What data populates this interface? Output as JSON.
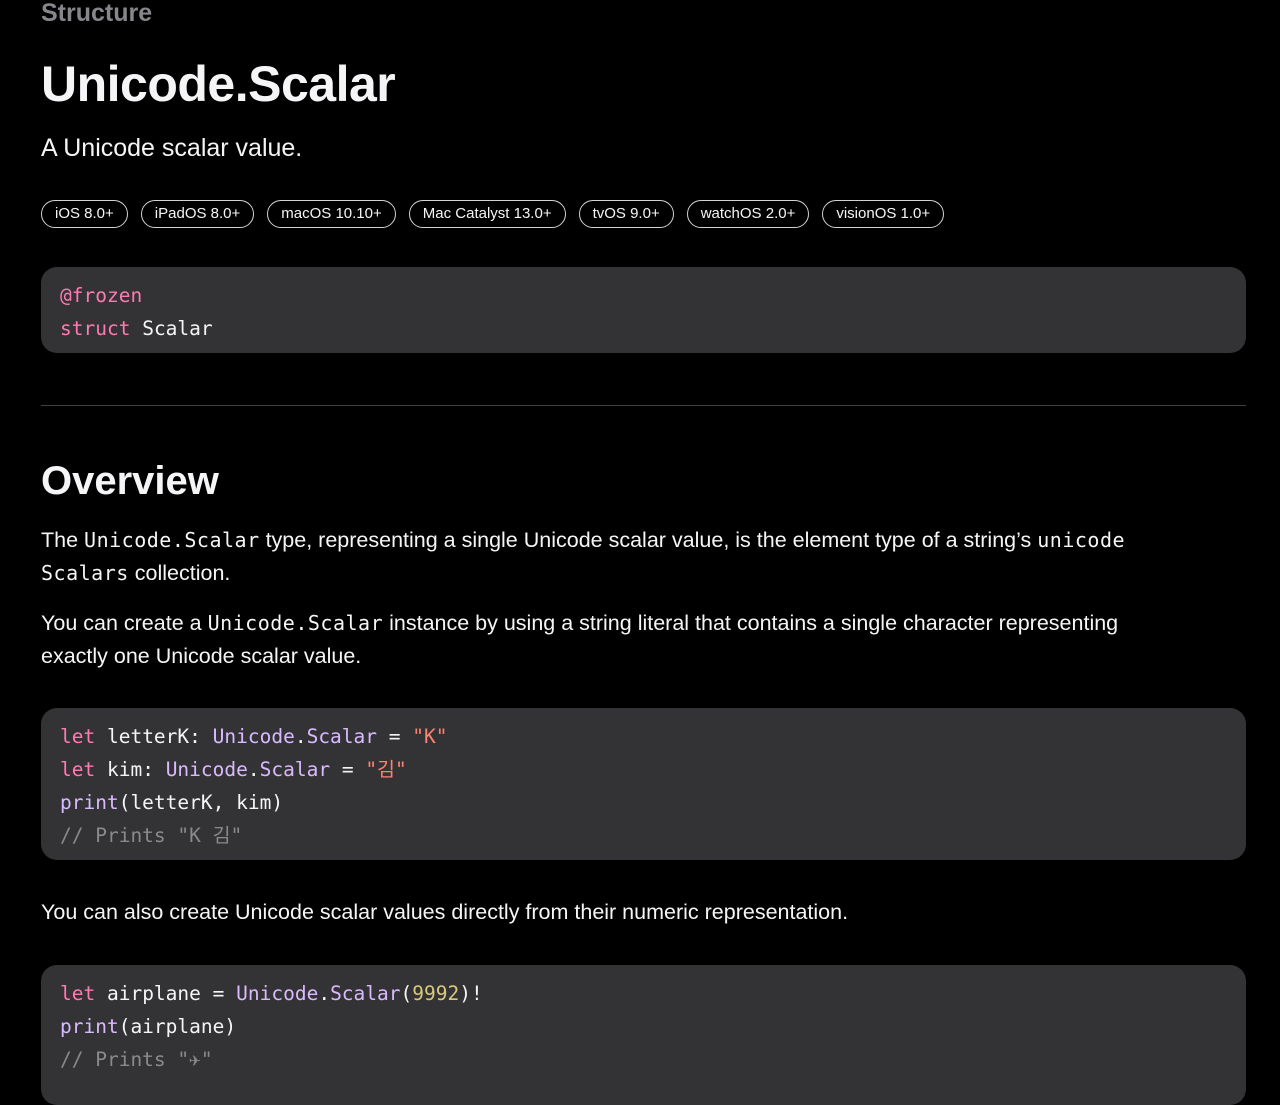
{
  "header": {
    "eyebrow": "Structure",
    "title": "Unicode.Scalar",
    "abstract": "A Unicode scalar value."
  },
  "availability": [
    "iOS 8.0+",
    "iPadOS 8.0+",
    "macOS 10.10+",
    "Mac Catalyst 13.0+",
    "tvOS 9.0+",
    "watchOS 2.0+",
    "visionOS 1.0+"
  ],
  "declaration": {
    "attribute": "@frozen",
    "keyword": "struct",
    "name": "Scalar"
  },
  "overview": {
    "heading": "Overview",
    "p1": {
      "t1": "The ",
      "c1": "Unicode.Scalar",
      "t2": " type, representing a single Unicode scalar value, is the element type of a string’s ",
      "c2a": "unicode",
      "c2b": "Scalars",
      "t3": " collection."
    },
    "p2": {
      "t1": "You can create a ",
      "c1": "Unicode.Scalar",
      "t2": " instance by using a string literal that contains a single character representing",
      "t3": "exactly one Unicode scalar value."
    },
    "p3": "You can also create Unicode scalar values directly from their numeric representation."
  },
  "code_example_1": {
    "line1": {
      "kw": "let",
      "ident": " letterK: ",
      "ty1": "Unicode",
      "dot": ".",
      "ty2": "Scalar",
      "op": " = ",
      "str": "\"K\""
    },
    "line2": {
      "kw": "let",
      "ident": " kim: ",
      "ty1": "Unicode",
      "dot": ".",
      "ty2": "Scalar",
      "op": " = ",
      "str": "\"김\""
    },
    "line3": {
      "fn": "print",
      "args": "(letterK, kim)"
    },
    "line4": "// Prints \"K 김\""
  },
  "code_example_2": {
    "line1": {
      "kw": "let",
      "ident": " airplane = ",
      "ty1": "Unicode",
      "dot": ".",
      "ty2": "Scalar",
      "open": "(",
      "num": "9992",
      "close": ")!"
    },
    "line2": {
      "fn": "print",
      "args": "(airplane)"
    },
    "line3": "// Prints \"✈\""
  },
  "colors": {
    "background": "#000000",
    "code_background": "#333336",
    "keyword": "#ff7ab2",
    "type": "#dabaff",
    "string": "#ff8170",
    "number": "#d9c97c",
    "comment": "#8a8a8e",
    "eyebrow": "#86868b"
  }
}
